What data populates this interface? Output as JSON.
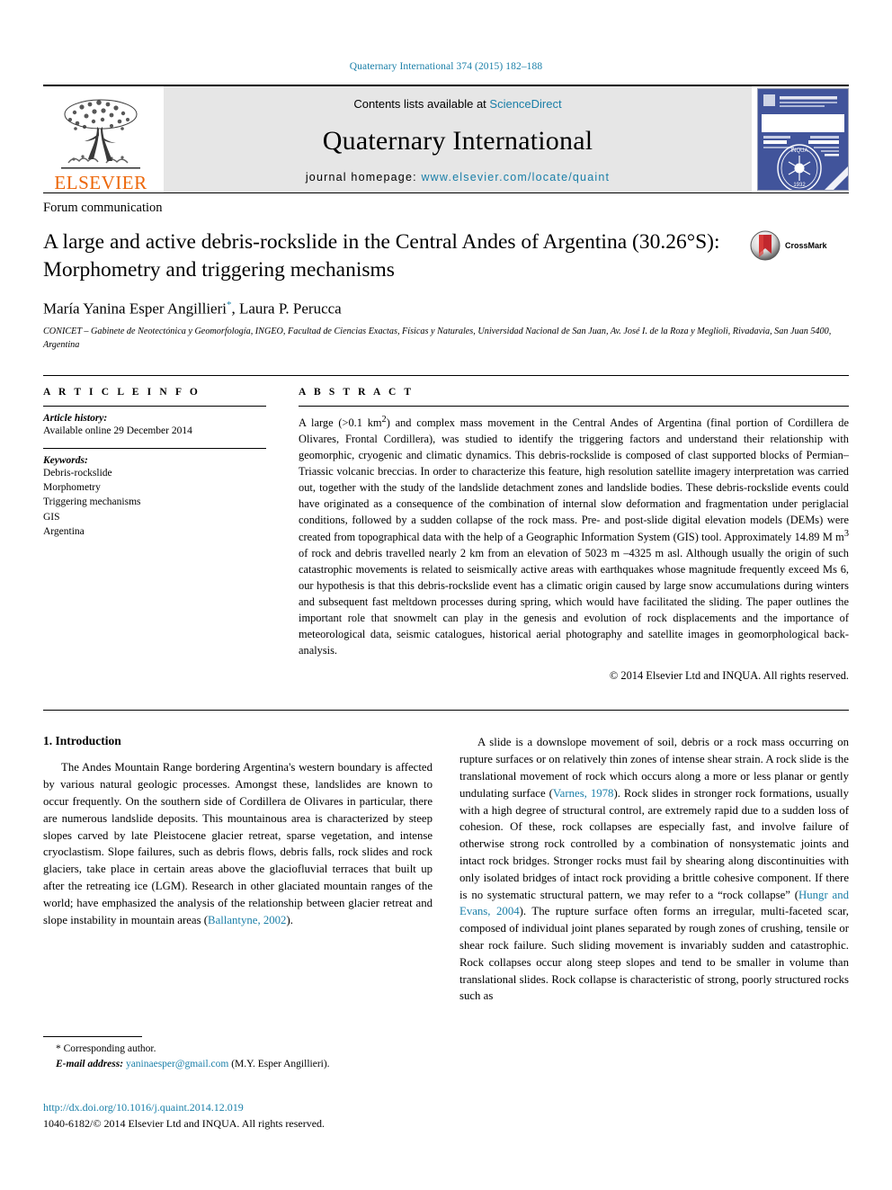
{
  "running_head": "Quaternary International 374 (2015) 182–188",
  "masthead": {
    "publisher": "ELSEVIER",
    "contents_prefix": "Contents lists available at ",
    "contents_link": "ScienceDirect",
    "journal_name": "Quaternary International",
    "homepage_prefix": "journal homepage: ",
    "homepage_url": "www.elsevier.com/locate/quaint",
    "cover_title": "QUATERNARY INTERNATIONAL"
  },
  "article": {
    "type": "Forum communication",
    "title": "A large and active debris-rockslide in the Central Andes of Argentina (30.26°S): Morphometry and triggering mechanisms",
    "crossmark_label": "CrossMark",
    "authors": "María Yanina Esper Angillieri",
    "authors_rest": ", Laura P. Perucca",
    "corresponding_marker": "*",
    "affiliation": "CONICET – Gabinete de Neotectónica y Geomorfología, INGEO, Facultad de Ciencias Exactas, Físicas y Naturales, Universidad Nacional de San Juan, Av. José I. de la Roza y Meglioli, Rivadavia, San Juan 5400, Argentina"
  },
  "article_info": {
    "label": "A R T I C L E   I N F O",
    "history_head": "Article history:",
    "history_line": "Available online 29 December 2014",
    "keywords_head": "Keywords:",
    "keywords": [
      "Debris-rockslide",
      "Morphometry",
      "Triggering mechanisms",
      "GIS",
      "Argentina"
    ]
  },
  "abstract": {
    "label": "A B S T R A C T",
    "text": "A large (>0.1 km2) and complex mass movement in the Central Andes of Argentina (final portion of Cordillera de Olivares, Frontal Cordillera), was studied to identify the triggering factors and understand their relationship with geomorphic, cryogenic and climatic dynamics. This debris-rockslide is composed of clast supported blocks of Permian–Triassic volcanic breccias. In order to characterize this feature, high resolution satellite imagery interpretation was carried out, together with the study of the landslide detachment zones and landslide bodies. These debris-rockslide events could have originated as a consequence of the combination of internal slow deformation and fragmentation under periglacial conditions, followed by a sudden collapse of the rock mass. Pre- and post-slide digital elevation models (DEMs) were created from topographical data with the help of a Geographic Information System (GIS) tool. Approximately 14.89 M m3 of rock and debris travelled nearly 2 km from an elevation of 5023 m –4325 m asl. Although usually the origin of such catastrophic movements is related to seismically active areas with earthquakes whose magnitude frequently exceed Ms 6, our hypothesis is that this debris-rockslide event has a climatic origin caused by large snow accumulations during winters and subsequent fast meltdown processes during spring, which would have facilitated the sliding. The paper outlines the important role that snowmelt can play in the genesis and evolution of rock displacements and the importance of meteorological data, seismic catalogues, historical aerial photography and satellite images in geomorphological back-analysis.",
    "copyright": "© 2014 Elsevier Ltd and INQUA. All rights reserved."
  },
  "body": {
    "section_heading": "1. Introduction",
    "left_paragraph_part1": "The Andes Mountain Range bordering Argentina's western boundary is affected by various natural geologic processes. Amongst these, landslides are known to occur frequently. On the southern side of Cordillera de Olivares in particular, there are numerous landslide deposits. This mountainous area is characterized by steep slopes carved by late Pleistocene glacier retreat, sparse vegetation, and intense cryoclastism. Slope failures, such as debris flows, debris falls, rock slides and rock glaciers, take place in certain areas above the glaciofluvial terraces that built up after the retreating ice (LGM). Research in other glaciated mountain ranges of the world; have emphasized the analysis of the relationship between glacier retreat and slope instability in mountain areas (",
    "left_ref1": "Ballantyne, 2002",
    "left_paragraph_part2": ").",
    "right_part1": "A slide is a downslope movement of soil, debris or a rock mass occurring on rupture surfaces or on relatively thin zones of intense shear strain. A rock slide is the translational movement of rock which occurs along a more or less planar or gently undulating surface (",
    "right_ref1": "Varnes, 1978",
    "right_part2": "). Rock slides in stronger rock formations, usually with a high degree of structural control, are extremely rapid due to a sudden loss of cohesion. Of these, rock collapses are especially fast, and involve failure of otherwise strong rock controlled by a combination of nonsystematic joints and intact rock bridges. Stronger rocks must fail by shearing along discontinuities with only isolated bridges of intact rock providing a brittle cohesive component. If there is no systematic structural pattern, we may refer to a “rock collapse” (",
    "right_ref2": "Hungr and Evans, 2004",
    "right_part3": "). The rupture surface often forms an irregular, multi-faceted scar, composed of individual joint planes separated by rough zones of crushing, tensile or shear rock failure. Such sliding movement is invariably sudden and catastrophic. Rock collapses occur along steep slopes and tend to be smaller in volume than translational slides. Rock collapse is characteristic of strong, poorly structured rocks such as"
  },
  "footer": {
    "corresponding_marker": "*",
    "corresponding_text": "Corresponding author.",
    "email_label": "E-mail address:",
    "email": "yaninaesper@gmail.com",
    "email_owner": "(M.Y. Esper Angillieri).",
    "doi": "http://dx.doi.org/10.1016/j.quaint.2014.12.019",
    "issn_line": "1040-6182/© 2014 Elsevier Ltd and INQUA. All rights reserved."
  },
  "colors": {
    "link": "#1a7fa8",
    "elsevier_orange": "#ec6608",
    "cover_blue": "#41549b",
    "masthead_gray": "#e6e6e6"
  }
}
